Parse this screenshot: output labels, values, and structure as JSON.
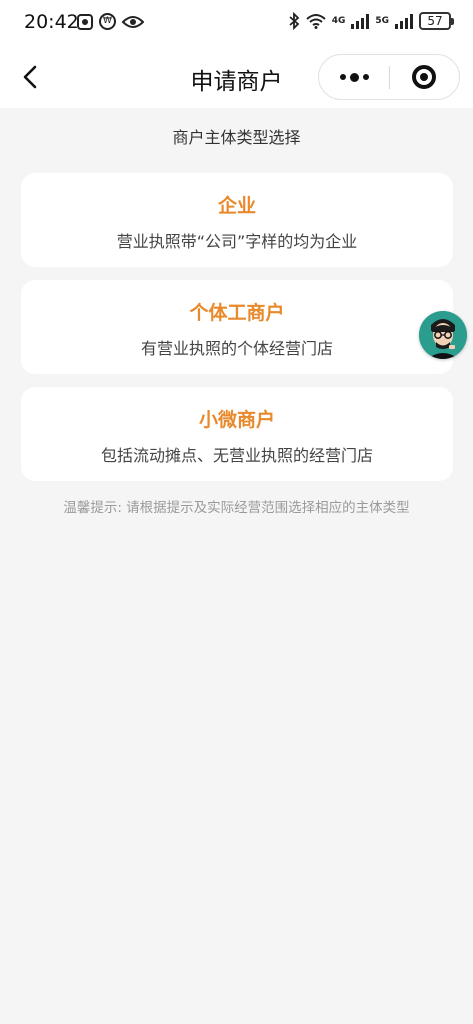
{
  "status_bar": {
    "time": "20:42",
    "network_1": "4G",
    "network_2": "5G",
    "battery": "57"
  },
  "nav": {
    "title": "申请商户",
    "back_icon": "chevron-left-icon",
    "more_icon": "more-dots-icon",
    "close_icon": "target-circle-icon"
  },
  "main": {
    "section_title": "商户主体类型选择",
    "options": [
      {
        "title": "企业",
        "desc": "营业执照带“公司”字样的均为企业"
      },
      {
        "title": "个体工商户",
        "desc": "有营业执照的个体经营门店"
      },
      {
        "title": "小微商户",
        "desc": "包括流动摊点、无营业执照的经营门店"
      }
    ],
    "tip": "温馨提示: 请根据提示及实际经营范围选择相应的主体类型"
  },
  "colors": {
    "accent": "#e8892c",
    "background": "#f5f5f5",
    "card": "#ffffff",
    "tip_text": "#9a9a9a"
  }
}
